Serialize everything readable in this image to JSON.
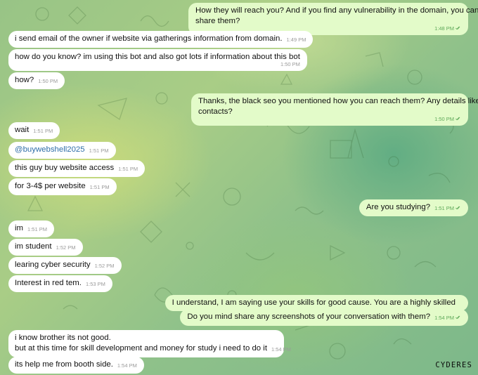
{
  "chat": {
    "messages": [
      {
        "id": "m1",
        "direction": "out",
        "lines": [
          "How they will reach you? And if you find any vulnerability in the domain, you can",
          "share them?"
        ],
        "time": "1:48 PM",
        "read": true
      },
      {
        "id": "m2",
        "direction": "in",
        "text": "i send email of the owner if website via gatherings information from domain.",
        "time": "1:49 PM"
      },
      {
        "id": "m3",
        "direction": "in",
        "text": "how do you know?  im using this bot and also got lots if information about this bot",
        "time": "1:50 PM"
      },
      {
        "id": "m4",
        "direction": "in",
        "text": "how?",
        "time": "1:50 PM"
      },
      {
        "id": "m5",
        "direction": "out",
        "lines": [
          "Thanks, the black seo you mentioned how you can reach them? Any details like",
          "contacts?"
        ],
        "time": "1:50 PM",
        "read": true
      },
      {
        "id": "m6",
        "direction": "in",
        "text": "wait",
        "time": "1:51 PM"
      },
      {
        "id": "m7",
        "direction": "in",
        "text": "@buywebshell2025",
        "time": "1:51 PM",
        "mention": true
      },
      {
        "id": "m8",
        "direction": "in",
        "text": "this guy buy website access",
        "time": "1:51 PM"
      },
      {
        "id": "m9",
        "direction": "in",
        "text": "for 3-4$ per website",
        "time": "1:51 PM"
      },
      {
        "id": "m10",
        "direction": "out",
        "text": "Are you studying?",
        "time": "1:51 PM",
        "read": true
      },
      {
        "id": "m11",
        "direction": "in",
        "text": "im",
        "time": "1:51 PM"
      },
      {
        "id": "m12",
        "direction": "in",
        "text": "im student",
        "time": "1:52 PM"
      },
      {
        "id": "m13",
        "direction": "in",
        "text": "learing cyber security",
        "time": "1:52 PM"
      },
      {
        "id": "m14",
        "direction": "in",
        "text": "Interest in red tem.",
        "time": "1:53 PM"
      },
      {
        "id": "m15",
        "direction": "out",
        "text": "I understand, I am saying use your skills for good cause. You are a highly skilled"
      },
      {
        "id": "m16",
        "direction": "out",
        "text": "Do you mind share any screenshots of your conversation with them?",
        "time": "1:54 PM",
        "read": true
      },
      {
        "id": "m17",
        "direction": "in",
        "lines": [
          "i know brother its not good.",
          "but at this time for skill development and money for study i need to do it"
        ],
        "time": "1:54 PM"
      },
      {
        "id": "m18",
        "direction": "in",
        "text": "its help me from booth side.",
        "time": "1:54 PM"
      }
    ]
  },
  "watermark": "CYDERES",
  "colors": {
    "incoming_bubble": "#ffffff",
    "outgoing_bubble": "#e3fbc9",
    "read_check": "#5fa95a",
    "mention_link": "#2f6ea8"
  },
  "icons": {
    "read_receipt": "double-check-icon"
  }
}
